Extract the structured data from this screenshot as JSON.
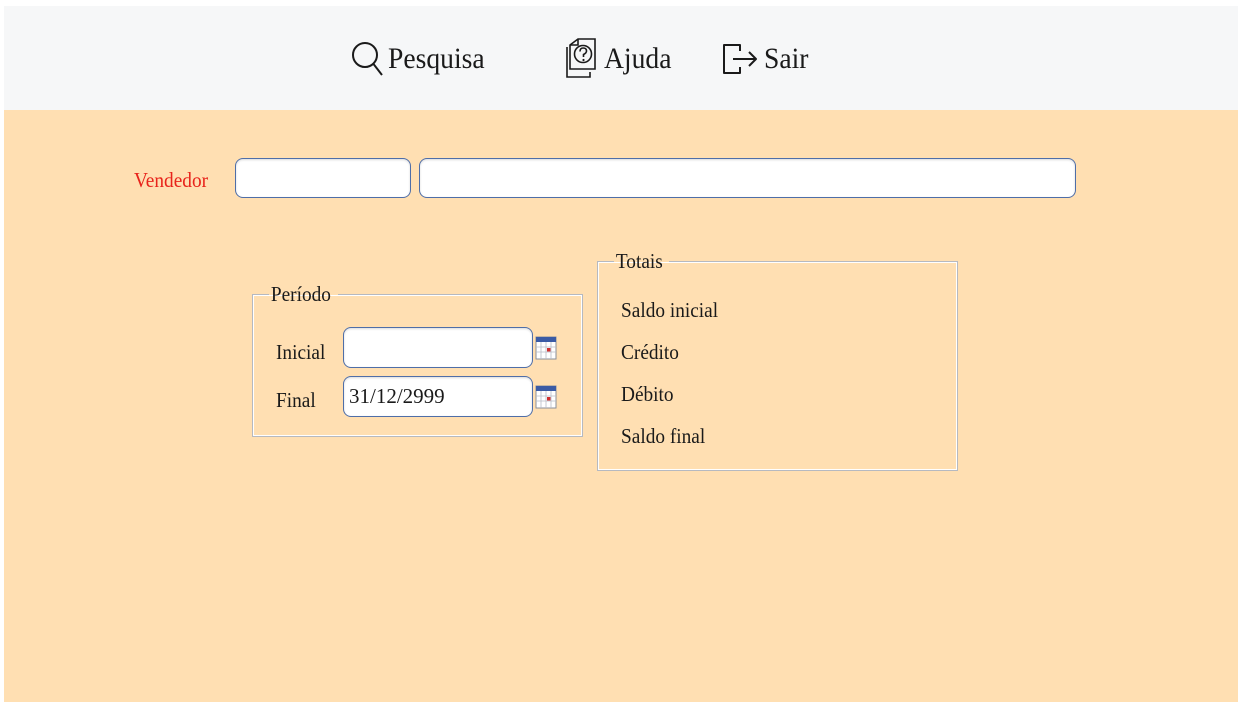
{
  "toolbar": {
    "search_label": "Pesquisa",
    "help_label": "Ajuda",
    "exit_label": "Sair"
  },
  "form": {
    "vendedor": {
      "label": "Vendedor",
      "code_value": "",
      "name_value": ""
    },
    "periodo": {
      "legend": "Período",
      "inicial_label": "Inicial",
      "inicial_value": "",
      "final_label": "Final",
      "final_value": "31/12/2999"
    },
    "totais": {
      "legend": "Totais",
      "saldo_inicial": "Saldo inicial",
      "credito": "Crédito",
      "debito": "Débito",
      "saldo_final": "Saldo final"
    }
  },
  "colors": {
    "toolbar_bg": "#f6f7f8",
    "form_bg": "#ffdfb2",
    "required_label": "#e8231b",
    "field_border": "#4f6ea8"
  },
  "icons": {
    "search": "magnifier-icon",
    "help": "help-document-icon",
    "exit": "exit-arrow-icon",
    "calendar": "calendar-icon"
  }
}
